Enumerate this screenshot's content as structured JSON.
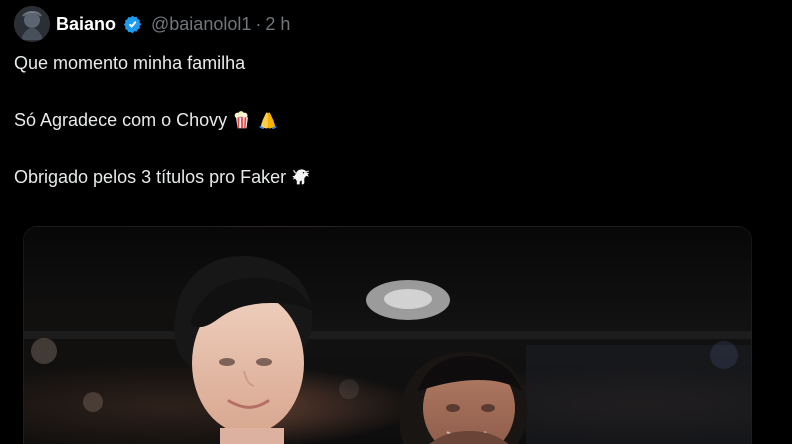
{
  "post": {
    "display_name": "Baiano",
    "handle": "@baianolol1",
    "separator": "·",
    "time": "2 h",
    "lines": [
      "Que momento minha familha",
      "Só Agradece com o Chovy",
      "Obrigado pelos 3 títulos pro Faker"
    ]
  },
  "icons": {
    "verified": "verified-badge-icon",
    "popcorn": "popcorn-emoji",
    "pray": "folded-hands-emoji",
    "goat": "goat-emoji"
  },
  "colors": {
    "background": "#000000",
    "primary_text": "#e7e9ea",
    "secondary_text": "#71767b",
    "verified_blue": "#1d9bf0"
  }
}
